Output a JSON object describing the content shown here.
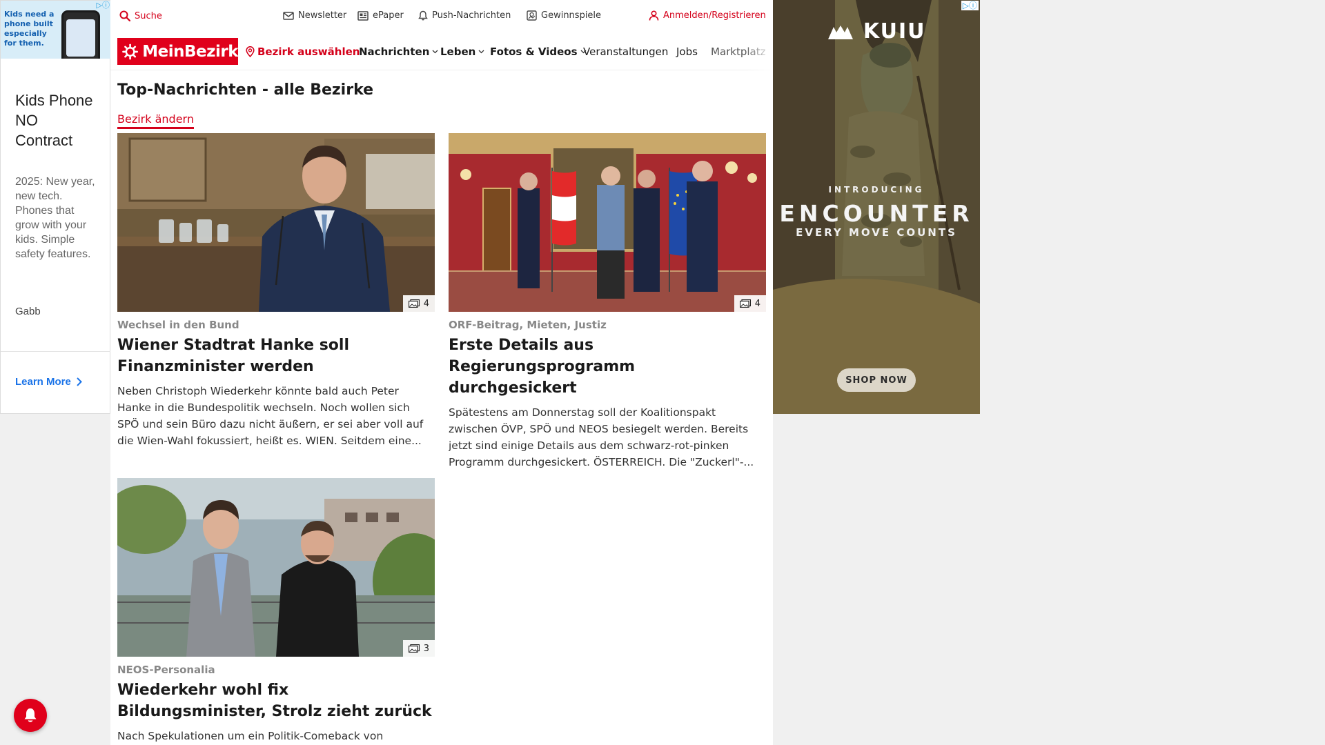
{
  "left_ad": {
    "badge": "▷ⓘ",
    "banner_text": "Kids need a phone built especially for them.",
    "headline": "Kids Phone NO Contract",
    "body": "2025: New year, new tech. Phones that grow with your kids. Simple safety features.",
    "brand": "Gabb",
    "cta": "Learn More"
  },
  "utility": {
    "search": "Suche",
    "newsletter": "Newsletter",
    "epaper": "ePaper",
    "push": "Push-Nachrichten",
    "games": "Gewinnspiele",
    "login": "Anmelden/Registrieren"
  },
  "nav": {
    "logo": "MeinBezirk",
    "district": "Bezirk auswählen",
    "items": [
      "Nachrichten",
      "Leben",
      "Fotos & Videos",
      "Veranstaltungen",
      "Jobs",
      "Marktplatz"
    ]
  },
  "section": {
    "title": "Top-Nachrichten - alle Bezirke",
    "change_link": "Bezirk ändern"
  },
  "articles": [
    {
      "kicker": "Wechsel in den Bund",
      "title": "Wiener Stadtrat Hanke soll Finanzminister werden",
      "teaser": "Neben Christoph Wiederkehr könnte bald auch Peter Hanke in die Bundespolitik wechseln. Noch wollen sich SPÖ und sein Büro dazu nicht äußern, er sei aber voll auf die Wien-Wahl fokussiert, heißt es. WIEN. Seitdem eine...",
      "image_count": "4"
    },
    {
      "kicker": "ORF-Beitrag, Mieten, Justiz",
      "title": "Erste Details aus Regierungsprogramm durchgesickert",
      "teaser": "Spätestens am Donnerstag soll der Koalitionspakt zwischen ÖVP, SPÖ und NEOS besiegelt werden. Bereits jetzt sind einige Details aus dem schwarz-rot-pinken Programm durchgesickert.  ÖSTERREICH. Die \"Zuckerl\"-...",
      "image_count": "4"
    },
    {
      "kicker": "NEOS-Personalia",
      "title": "Wiederkehr wohl fix Bildungsminister, Strolz zieht zurück",
      "teaser": "Nach Spekulationen um ein Politik-Comeback von",
      "image_count": "3"
    }
  ],
  "right_ad": {
    "badge": "▷ⓘ",
    "brand": "KUIU",
    "intro": "INTRODUCING",
    "headline": "ENCOUNTER",
    "tagline": "EVERY MOVE COUNTS",
    "cta": "SHOP NOW"
  },
  "colors": {
    "brand_red": "#e0001b",
    "link_red": "#d4001a"
  }
}
